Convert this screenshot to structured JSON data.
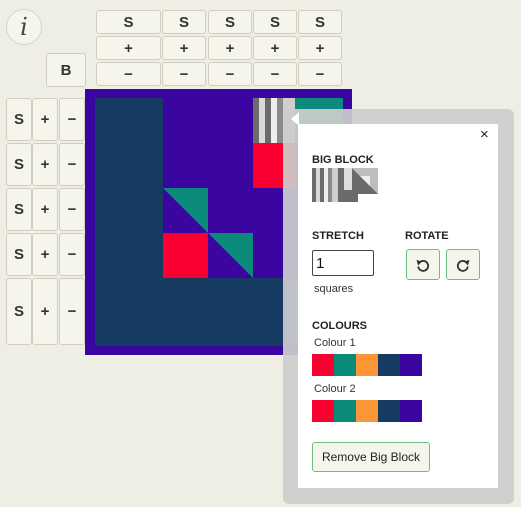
{
  "toolbar": {
    "info_symbol": "i",
    "big_block_button": "B"
  },
  "column_controls": {
    "count": 5,
    "stretch_label": "S",
    "add_label": "+",
    "remove_label": "−"
  },
  "row_controls": {
    "count": 5,
    "stretch_label": "S",
    "add_label": "+",
    "remove_label": "−"
  },
  "palette": {
    "red": "#fa0030",
    "teal": "#0b8a7a",
    "orange": "#fb9637",
    "navy": "#173a63",
    "purple": "#3b059f"
  },
  "panel": {
    "close_label": "×",
    "big_block_heading": "BIG BLOCK",
    "stretch_heading": "STRETCH",
    "stretch_value": "1",
    "stretch_units": "squares",
    "rotate_heading": "ROTATE",
    "rotate_left_icon": "rotate-left-icon",
    "rotate_right_icon": "rotate-right-icon",
    "colours_heading": "COLOURS",
    "colour1_label": "Colour 1",
    "colour2_label": "Colour 2",
    "colour_swatches": [
      "#fa0030",
      "#0b8a7a",
      "#fb9637",
      "#173a63",
      "#3b059f"
    ],
    "remove_button": "Remove Big Block"
  }
}
